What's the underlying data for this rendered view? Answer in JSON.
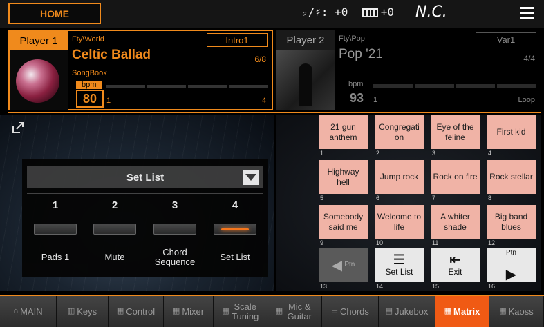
{
  "topbar": {
    "home_label": "HOME",
    "transpose": "♭/♯: +0",
    "octave": "+0",
    "chord": "N.C.",
    "menu_icon": "hamburger-menu-icon"
  },
  "player1": {
    "label": "Player 1",
    "style_path": "Fty\\World",
    "variation": "Intro1",
    "song_name": "Celtic Ballad",
    "meter": "6/8",
    "source": "SongBook",
    "bpm_label": "bpm",
    "bpm": "80",
    "bar_start": "1",
    "bar_end": "4"
  },
  "player2": {
    "label": "Player 2",
    "style_path": "Fty\\Pop",
    "variation": "Var1",
    "song_name": "Pop '21",
    "meter": "4/4",
    "bpm_label": "bpm",
    "bpm": "93",
    "bar_start": "1",
    "bar_end": "Loop"
  },
  "setlist": {
    "dropdown_value": "Set List",
    "items": [
      {
        "num": "1",
        "label": "Pads 1",
        "active": false
      },
      {
        "num": "2",
        "label": "Mute",
        "active": false
      },
      {
        "num": "3",
        "label": "Chord Sequence",
        "active": false
      },
      {
        "num": "4",
        "label": "Set List",
        "active": true
      }
    ]
  },
  "matrix": {
    "pads": [
      {
        "num": "1",
        "label": "21 gun anthem"
      },
      {
        "num": "2",
        "label": "Congregati on"
      },
      {
        "num": "3",
        "label": "Eye of the feline"
      },
      {
        "num": "4",
        "label": "First kid"
      },
      {
        "num": "5",
        "label": "Highway hell"
      },
      {
        "num": "6",
        "label": "Jump rock"
      },
      {
        "num": "7",
        "label": "Rock on fire"
      },
      {
        "num": "8",
        "label": "Rock stellar"
      },
      {
        "num": "9",
        "label": "Somebody said me"
      },
      {
        "num": "10",
        "label": "Welcome to life"
      },
      {
        "num": "11",
        "label": "A whiter shade"
      },
      {
        "num": "12",
        "label": "Big band blues"
      },
      {
        "num": "13",
        "label": "Ptn"
      },
      {
        "num": "14",
        "label": "Set List"
      },
      {
        "num": "15",
        "label": "Exit"
      },
      {
        "num": "16",
        "label": "Ptn"
      }
    ]
  },
  "bottom_tabs": [
    {
      "label": "MAIN",
      "icon": "home-icon"
    },
    {
      "label": "Keys",
      "icon": "keys-icon"
    },
    {
      "label": "Control",
      "icon": "control-icon"
    },
    {
      "label": "Mixer",
      "icon": "mixer-icon"
    },
    {
      "label": "Scale Tuning",
      "icon": "scale-icon"
    },
    {
      "label": "Mic & Guitar",
      "icon": "mic-icon"
    },
    {
      "label": "Chords",
      "icon": "chords-icon"
    },
    {
      "label": "Jukebox",
      "icon": "jukebox-icon"
    },
    {
      "label": "Matrix",
      "icon": "matrix-icon",
      "active": true
    },
    {
      "label": "Kaoss",
      "icon": "kaoss-icon"
    }
  ],
  "colors": {
    "accent": "#f08a1c",
    "pad": "#f0b3a6",
    "active_tab": "#f05a14"
  }
}
